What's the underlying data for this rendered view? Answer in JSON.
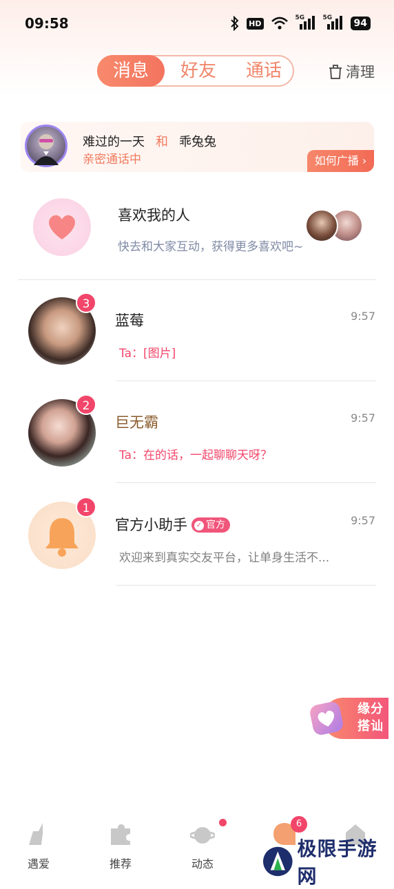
{
  "status_bar": {
    "time": "09:58",
    "hd": "HD",
    "net1": "5G",
    "net2": "5G",
    "battery": "94"
  },
  "header": {
    "tabs": [
      {
        "label": "消息",
        "active": true
      },
      {
        "label": "好友"
      },
      {
        "label": "通话"
      }
    ],
    "clean_label": "清理"
  },
  "banner": {
    "user_a": "难过的一天",
    "and": "和",
    "user_b": "乖兔兔",
    "status": "亲密通话中",
    "action_label": "如何广播"
  },
  "likes": {
    "title": "喜欢我的人",
    "subtitle": "快去和大家互动，获得更多喜欢吧~"
  },
  "chats": [
    {
      "name": "蓝莓",
      "time": "9:57",
      "preview": "Ta：[图片]",
      "unread": "3"
    },
    {
      "name": "巨无霸",
      "time": "9:57",
      "preview": "Ta：在的话，一起聊聊天呀？",
      "unread": "2"
    },
    {
      "name": "官方小助手",
      "badge": "官方",
      "time": "9:57",
      "preview": "欢迎来到真实交友平台，让单身生活不...",
      "unread": "1"
    }
  ],
  "floating_promo": {
    "line1": "缘分",
    "line2": "搭讪"
  },
  "bottom_nav": [
    {
      "label": "遇爱"
    },
    {
      "label": "推荐"
    },
    {
      "label": "动态"
    },
    {
      "label": "",
      "badge": "6"
    },
    {
      "label": ""
    }
  ],
  "watermark": "极限手游网",
  "colors": {
    "accent": "#f3745f",
    "badge": "#f2456a"
  }
}
